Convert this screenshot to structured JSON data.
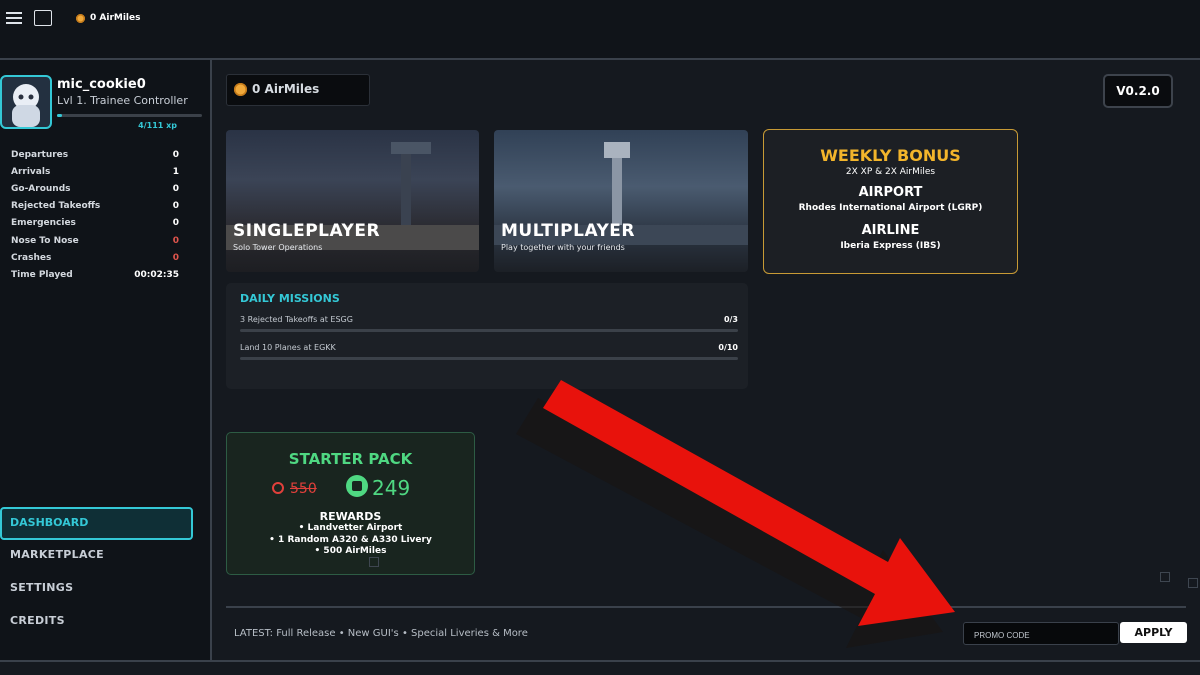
{
  "topbar": {
    "airmiles": "0 AirMiles"
  },
  "profile": {
    "username": "mic_cookie0",
    "level": "Lvl 1. Trainee Controller",
    "xp": "4/111 xp",
    "xp_fraction": 0.036
  },
  "stats": [
    {
      "label": "Departures",
      "value": "0",
      "highlight": false
    },
    {
      "label": "Arrivals",
      "value": "1",
      "highlight": false
    },
    {
      "label": "Go-Arounds",
      "value": "0",
      "highlight": false
    },
    {
      "label": "Rejected Takeoffs",
      "value": "0",
      "highlight": false
    },
    {
      "label": "Emergencies",
      "value": "0",
      "highlight": false
    },
    {
      "label": "Nose To Nose",
      "value": "0",
      "highlight": true
    },
    {
      "label": "Crashes",
      "value": "0",
      "highlight": true
    },
    {
      "label": "Time Played",
      "value": "00:02:35",
      "highlight": false
    }
  ],
  "nav": {
    "dashboard": "DASHBOARD",
    "marketplace": "MARKETPLACE",
    "settings": "SETTINGS",
    "credits": "CREDITS"
  },
  "main": {
    "airmiles": "0 AirMiles",
    "version": "V0.2.0"
  },
  "singleplayer": {
    "title": "SINGLEPLAYER",
    "subtitle": "Solo Tower Operations"
  },
  "multiplayer": {
    "title": "MULTIPLAYER",
    "subtitle": "Play together with your friends"
  },
  "weekly_bonus": {
    "title": "WEEKLY BONUS",
    "subtitle": "2X XP & 2X AirMiles",
    "airport_label": "AIRPORT",
    "airport": "Rhodes International Airport (LGRP)",
    "airline_label": "AIRLINE",
    "airline": "Iberia Express (IBS)"
  },
  "daily_missions": {
    "title": "DAILY MISSIONS",
    "items": [
      {
        "text": "3 Rejected Takeoffs at ESGG",
        "progress": "0/3"
      },
      {
        "text": "Land 10 Planes at EGKK",
        "progress": "0/10"
      }
    ]
  },
  "starter_pack": {
    "title": "STARTER PACK",
    "old_price": "550",
    "new_price": "249",
    "rewards_label": "REWARDS",
    "rewards": [
      "• Landvetter Airport",
      "• 1 Random A320 & A330 Livery",
      "• 500 AirMiles"
    ]
  },
  "footer": {
    "latest": "LATEST: Full Release • New GUI's • Special Liveries & More",
    "promo_placeholder": "PROMO CODE",
    "apply": "APPLY"
  },
  "colors": {
    "accent": "#34c8d6",
    "gold": "#f3b52b",
    "green": "#4fd882",
    "red": "#e1403b",
    "arrow": "#e8120c"
  },
  "icons": [
    "menu-icon",
    "chat-icon",
    "airmiles-coin-icon",
    "robux-icon",
    "arrow-overlay"
  ]
}
